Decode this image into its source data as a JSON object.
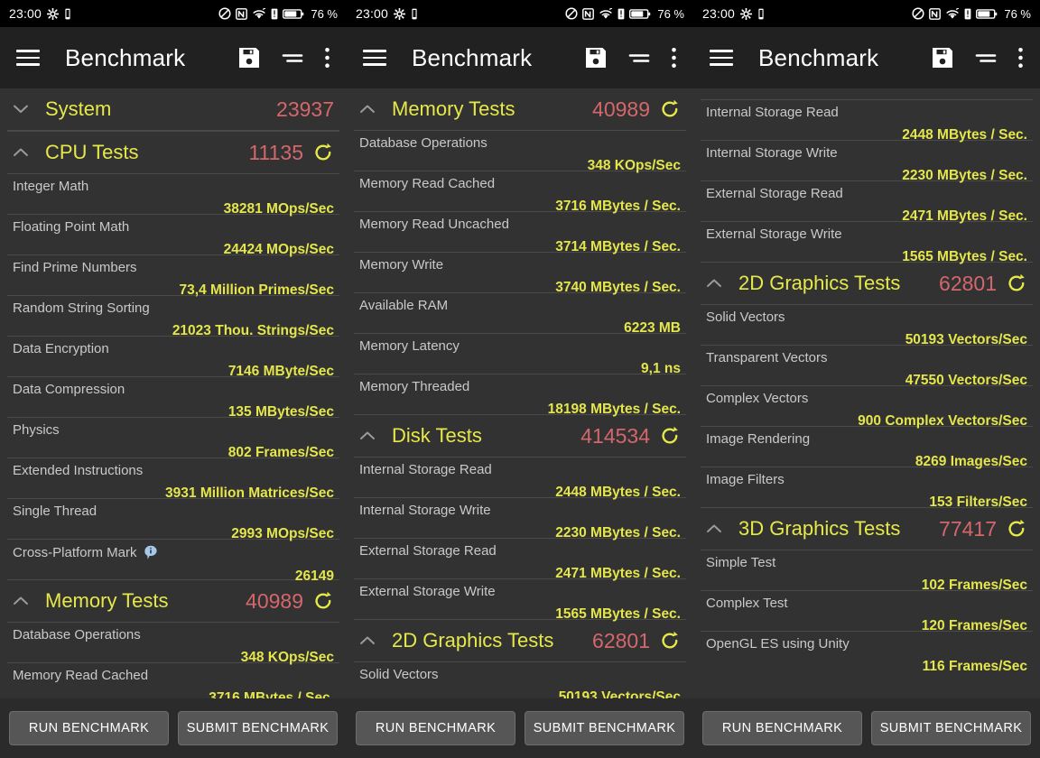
{
  "status_bar": {
    "clock": "23:00",
    "battery_percent": "76 %",
    "icons": [
      "gear-icon",
      "vibrate-icon",
      "dnd-icon",
      "nfc-icon",
      "wifi-icon",
      "alert-icon",
      "battery-icon"
    ]
  },
  "appbar": {
    "title": "Benchmark",
    "menu_icon": "hamburger-icon",
    "save_icon": "save-floppy-icon",
    "sort_icon": "sort-icon",
    "overflow_icon": "overflow-menu-icon"
  },
  "bottom_bar": {
    "run_label": "RUN BENCHMARK",
    "submit_label": "SUBMIT BENCHMARK"
  },
  "colors": {
    "section_title": "#e6e84a",
    "section_score": "#d4676b",
    "test_value": "#e4e64b",
    "test_label": "#c9c9c9",
    "appbar_bg": "#212121",
    "panel_bg": "#323232",
    "info_icon": "#a8c8e8"
  },
  "sections": {
    "system": {
      "title": "System",
      "score": "23937",
      "state": "collapsed"
    },
    "cpu": {
      "title": "CPU Tests",
      "score": "11135",
      "state": "expanded"
    },
    "memory": {
      "title": "Memory Tests",
      "score": "40989",
      "state": "expanded"
    },
    "disk": {
      "title": "Disk Tests",
      "score": "414534",
      "state": "expanded"
    },
    "gfx2d": {
      "title": "2D Graphics Tests",
      "score": "62801",
      "state": "expanded"
    },
    "gfx3d": {
      "title": "3D Graphics Tests",
      "score": "77417",
      "state": "expanded"
    }
  },
  "tests": {
    "cpu": [
      {
        "label": "Integer Math",
        "value": "38281 MOps/Sec"
      },
      {
        "label": "Floating Point Math",
        "value": "24424 MOps/Sec"
      },
      {
        "label": "Find Prime Numbers",
        "value": "73,4 Million Primes/Sec"
      },
      {
        "label": "Random String Sorting",
        "value": "21023 Thou. Strings/Sec"
      },
      {
        "label": "Data Encryption",
        "value": "7146 MByte/Sec"
      },
      {
        "label": "Data Compression",
        "value": "135 MBytes/Sec"
      },
      {
        "label": "Physics",
        "value": "802 Frames/Sec"
      },
      {
        "label": "Extended Instructions",
        "value": "3931 Million Matrices/Sec"
      },
      {
        "label": "Single Thread",
        "value": "2993 MOps/Sec"
      },
      {
        "label": "Cross-Platform Mark",
        "value": "26149",
        "has_info": true
      }
    ],
    "memory": [
      {
        "label": "Database Operations",
        "value": "348 KOps/Sec"
      },
      {
        "label": "Memory Read Cached",
        "value": "3716 MBytes / Sec."
      },
      {
        "label": "Memory Read Uncached",
        "value": "3714 MBytes / Sec."
      },
      {
        "label": "Memory Write",
        "value": "3740 MBytes / Sec."
      },
      {
        "label": "Available RAM",
        "value": "6223 MB"
      },
      {
        "label": "Memory Latency",
        "value": "9,1 ns"
      },
      {
        "label": "Memory Threaded",
        "value": "18198 MBytes / Sec."
      }
    ],
    "disk": [
      {
        "label": "Internal Storage Read",
        "value": "2448 MBytes / Sec."
      },
      {
        "label": "Internal Storage Write",
        "value": "2230 MBytes / Sec."
      },
      {
        "label": "External Storage Read",
        "value": "2471 MBytes / Sec."
      },
      {
        "label": "External Storage Write",
        "value": "1565 MBytes / Sec."
      }
    ],
    "gfx2d": [
      {
        "label": "Solid Vectors",
        "value": "50193 Vectors/Sec"
      },
      {
        "label": "Transparent Vectors",
        "value": "47550 Vectors/Sec"
      },
      {
        "label": "Complex Vectors",
        "value": "900 Complex Vectors/Sec"
      },
      {
        "label": "Image Rendering",
        "value": "8269 Images/Sec"
      },
      {
        "label": "Image Filters",
        "value": "153 Filters/Sec"
      }
    ],
    "gfx3d": [
      {
        "label": "Simple Test",
        "value": "102 Frames/Sec"
      },
      {
        "label": "Complex Test",
        "value": "120 Frames/Sec"
      },
      {
        "label": "OpenGL ES using Unity",
        "value": "116 Frames/Sec"
      }
    ]
  },
  "panels": [
    {
      "name": "panel-1",
      "blocks": [
        {
          "kind": "section",
          "key": "system"
        },
        {
          "kind": "section",
          "key": "cpu"
        },
        {
          "kind": "tests",
          "key": "cpu",
          "from": 0,
          "to": 10
        },
        {
          "kind": "section",
          "key": "memory"
        },
        {
          "kind": "tests",
          "key": "memory",
          "from": 0,
          "to": 2
        }
      ]
    },
    {
      "name": "panel-2",
      "blocks": [
        {
          "kind": "section",
          "key": "memory"
        },
        {
          "kind": "tests",
          "key": "memory",
          "from": 0,
          "to": 7
        },
        {
          "kind": "section",
          "key": "disk"
        },
        {
          "kind": "tests",
          "key": "disk",
          "from": 0,
          "to": 4
        },
        {
          "kind": "section",
          "key": "gfx2d"
        },
        {
          "kind": "tests",
          "key": "gfx2d",
          "from": 0,
          "to": 1
        }
      ]
    },
    {
      "name": "panel-3",
      "blocks": [
        {
          "kind": "clipped-section",
          "key": "disk"
        },
        {
          "kind": "tests",
          "key": "disk",
          "from": 0,
          "to": 4
        },
        {
          "kind": "section",
          "key": "gfx2d"
        },
        {
          "kind": "tests",
          "key": "gfx2d",
          "from": 0,
          "to": 5
        },
        {
          "kind": "section",
          "key": "gfx3d"
        },
        {
          "kind": "tests",
          "key": "gfx3d",
          "from": 0,
          "to": 3
        }
      ]
    }
  ]
}
